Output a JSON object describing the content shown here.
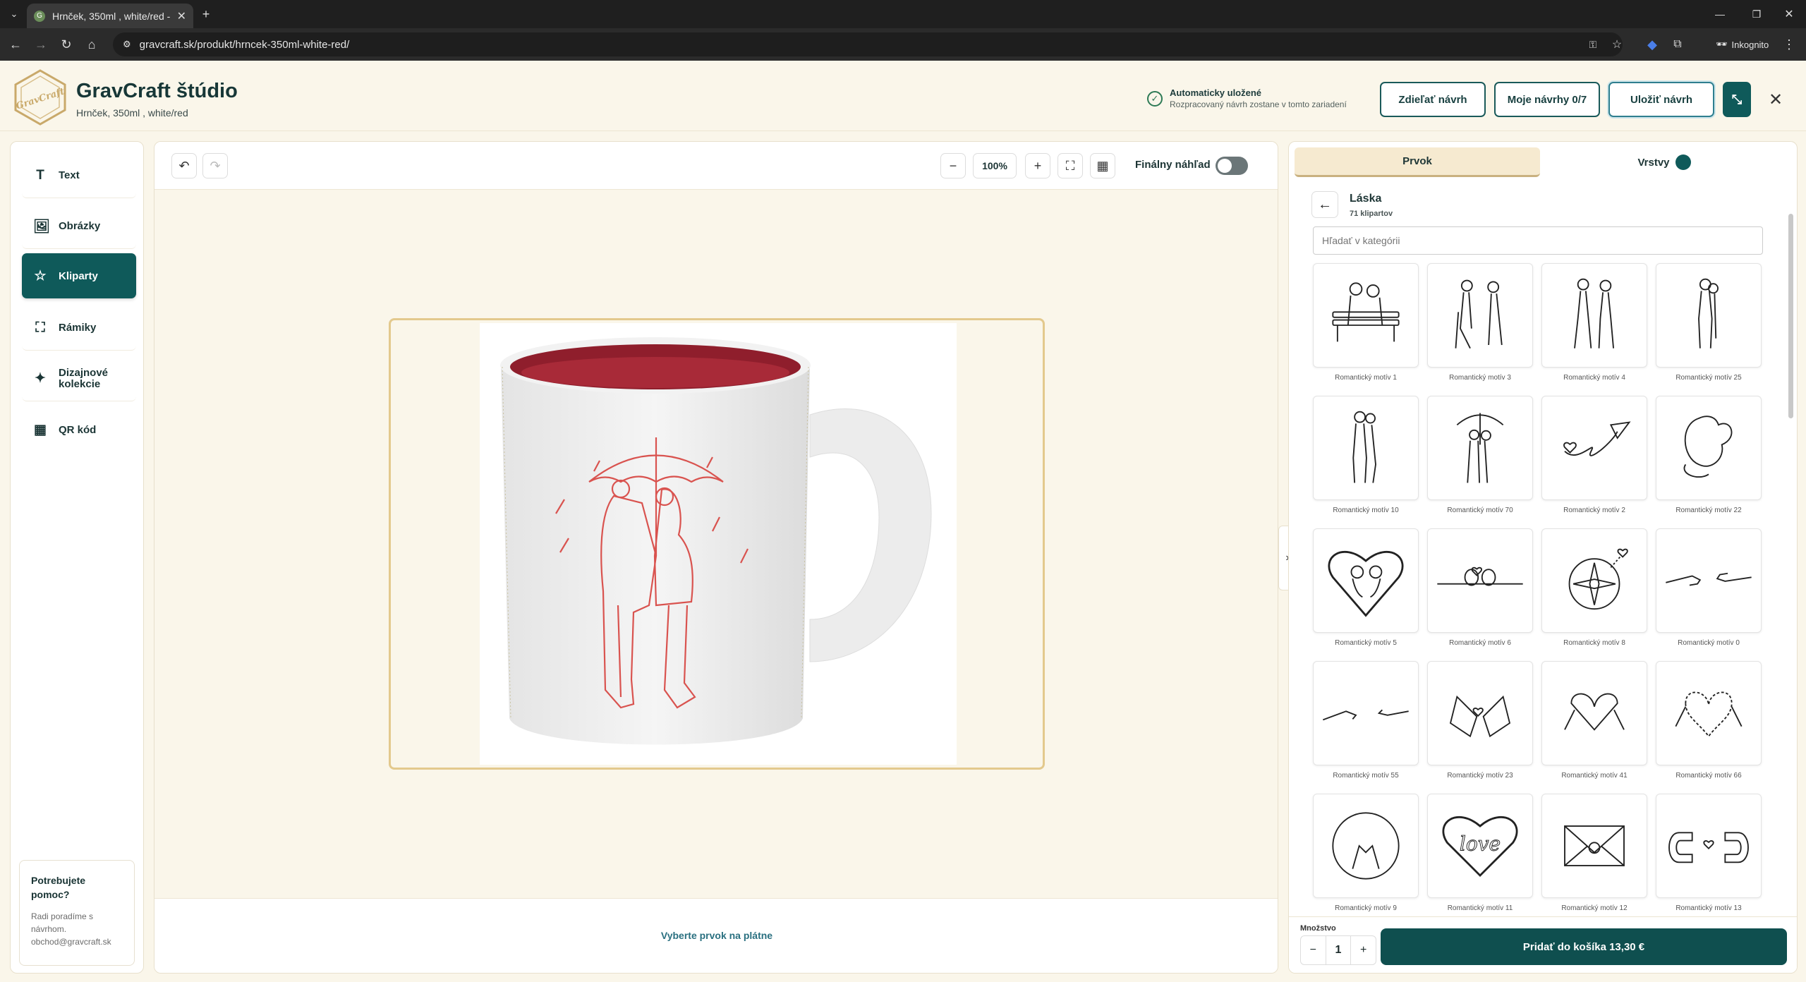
{
  "browser": {
    "tab_title": "Hrnček, 350ml , white/red -",
    "url": "gravcraft.sk/produkt/hrncek-350ml-white-red/",
    "incognito_label": "Inkognito"
  },
  "header": {
    "brand": "GravCraft štúdio",
    "product": "Hrnček, 350ml , white/red",
    "autosave_title": "Automaticky uložené",
    "autosave_sub": "Rozpracovaný návrh zostane v tomto zariadení",
    "share_label": "Zdieľať návrh",
    "my_designs_label": "Moje návrhy 0/7",
    "save_label": "Uložiť návrh"
  },
  "sidebar": {
    "items": [
      {
        "label": "Text",
        "icon": "text-icon"
      },
      {
        "label": "Obrázky",
        "icon": "image-icon"
      },
      {
        "label": "Kliparty",
        "icon": "star-icon"
      },
      {
        "label": "Rámiky",
        "icon": "frame-icon"
      },
      {
        "label": "Dizajnové kolekcie",
        "icon": "sparkle-icon"
      },
      {
        "label": "QR kód",
        "icon": "qr-icon"
      }
    ],
    "active": "Kliparty",
    "help_title": "Potrebujete pomoc?",
    "help_text": "Radi poradíme s návrhom.",
    "help_email": "obchod@gravcraft.sk"
  },
  "canvas": {
    "zoom": "100%",
    "final_preview_label": "Finálny náhľad",
    "final_preview_on": false,
    "hint": "Vyberte prvok na plátne"
  },
  "panel": {
    "tab_element": "Prvok",
    "tab_layers": "Vrstvy",
    "category_title": "Láska",
    "category_count": "71 klipartov",
    "search_placeholder": "Hľadať v kategórii",
    "cliparts": [
      "Romantický motív 1",
      "Romantický motív 3",
      "Romantický motív 4",
      "Romantický motív 25",
      "Romantický motív 10",
      "Romantický motív 70",
      "Romantický motív 2",
      "Romantický motív 22",
      "Romantický motív 5",
      "Romantický motív 6",
      "Romantický motív 8",
      "Romantický motív 0",
      "Romantický motív 55",
      "Romantický motív 23",
      "Romantický motív 41",
      "Romantický motív 66",
      "Romantický motív 9",
      "Romantický motív 11",
      "Romantický motív 12",
      "Romantický motív 13"
    ],
    "quantity_label": "Množstvo",
    "quantity": "1",
    "add_to_cart": "Pridať do košíka 13,30 €"
  },
  "colors": {
    "accent": "#0f5a5a",
    "background": "#faf6ea",
    "mug_red": "#d9534f"
  }
}
